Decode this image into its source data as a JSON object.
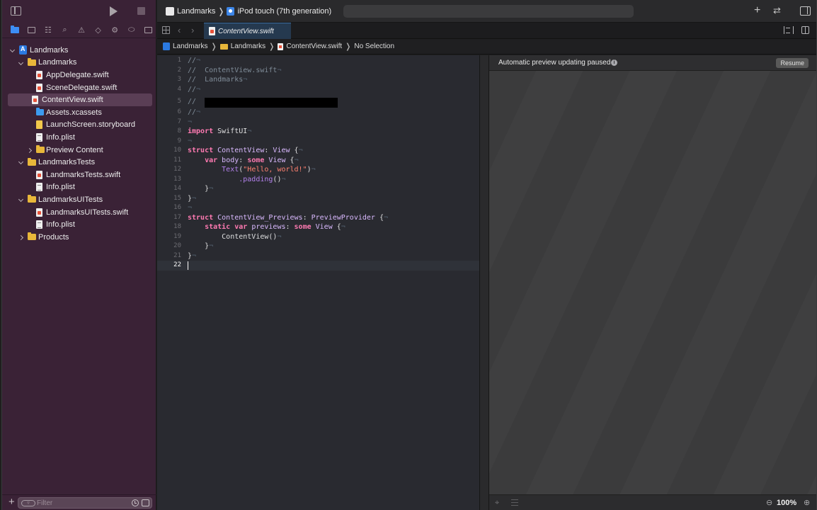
{
  "toolbar": {
    "scheme": "Landmarks",
    "device": "iPod touch (7th generation)"
  },
  "tab": {
    "active_label": "ContentView.swift"
  },
  "jumpbar": {
    "items": [
      "Landmarks",
      "Landmarks",
      "ContentView.swift",
      "No Selection"
    ]
  },
  "navigator": {
    "items": [
      {
        "label": "Landmarks"
      },
      {
        "label": "Landmarks"
      },
      {
        "label": "AppDelegate.swift"
      },
      {
        "label": "SceneDelegate.swift"
      },
      {
        "label": "ContentView.swift"
      },
      {
        "label": "Assets.xcassets"
      },
      {
        "label": "LaunchScreen.storyboard"
      },
      {
        "label": "Info.plist"
      },
      {
        "label": "Preview Content"
      },
      {
        "label": "LandmarksTests"
      },
      {
        "label": "LandmarksTests.swift"
      },
      {
        "label": "Info.plist"
      },
      {
        "label": "LandmarksUITests"
      },
      {
        "label": "LandmarksUITests.swift"
      },
      {
        "label": "Info.plist"
      },
      {
        "label": "Products"
      }
    ],
    "filter_placeholder": "Filter"
  },
  "editor": {
    "line_numbers": [
      "1",
      "2",
      "3",
      "4",
      "5",
      "6",
      "7",
      "8",
      "9",
      "10",
      "11",
      "12",
      "13",
      "14",
      "15",
      "16",
      "17",
      "18",
      "19",
      "20",
      "21",
      "22"
    ],
    "current_line": "22",
    "code": {
      "l1": "//",
      "l2": "//  ContentView.swift",
      "l3": "//  Landmarks",
      "l4": "//",
      "l5": "// ",
      "l6": "//",
      "l8_kw": "import",
      "l8_rest": " SwiftUI",
      "l10_kw": "struct",
      "l10_type": " ContentView",
      "l10_sep": ": ",
      "l10_proto": "View",
      "l10_end": " {",
      "l11_kw": "    var",
      "l11_name": " body",
      "l11_sep": ": ",
      "l11_kw2": "some",
      "l11_proto": " View",
      "l11_end": " {",
      "l12_fn": "        Text",
      "l12_open": "(",
      "l12_str": "\"Hello, world!\"",
      "l12_close": ")",
      "l13_fn": "            .padding",
      "l13_end": "()",
      "l14": "    }",
      "l15": "}",
      "l17_kw": "struct",
      "l17_type": " ContentView_Previews",
      "l17_sep": ": ",
      "l17_proto": "PreviewProvider",
      "l17_end": " {",
      "l18_kw": "    static var",
      "l18_name": " previews",
      "l18_sep": ": ",
      "l18_kw2": "some",
      "l18_proto": " View",
      "l18_end": " {",
      "l19_fn": "        ContentView",
      "l19_end": "()",
      "l20": "    }",
      "l21": "}"
    }
  },
  "canvas": {
    "banner": "Automatic preview updating paused",
    "info_glyph": "i",
    "resume_label": "Resume",
    "zoom": "100%"
  },
  "colors": {
    "sidebar_bg": "#3a2236",
    "editor_bg": "#292a30",
    "keyword": "#ff7ab2",
    "string": "#ff8170",
    "accent": "#3d8ef5"
  }
}
